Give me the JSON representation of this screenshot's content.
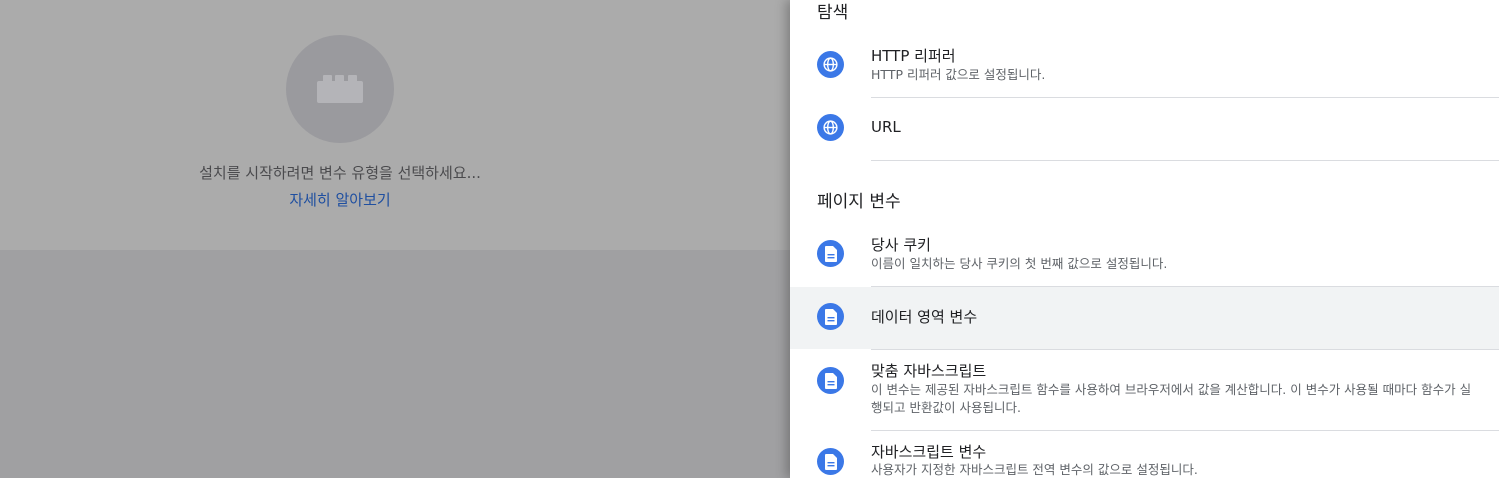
{
  "background": {
    "prompt": "설치를 시작하려면 변수 유형을 선택하세요...",
    "learn_more": "자세히 알아보기"
  },
  "panel": {
    "sections": [
      {
        "title": "탐색",
        "items": [
          {
            "title": "HTTP 리퍼러",
            "description": "HTTP 리퍼러 값으로 설정됩니다.",
            "icon": "globe-icon"
          },
          {
            "title": "URL",
            "description": "",
            "icon": "globe-icon"
          }
        ]
      },
      {
        "title": "페이지 변수",
        "items": [
          {
            "title": "당사 쿠키",
            "description": "이름이 일치하는 당사 쿠키의 첫 번째 값으로 설정됩니다.",
            "icon": "document-icon"
          },
          {
            "title": "데이터 영역 변수",
            "description": "",
            "icon": "document-icon",
            "selected": true
          },
          {
            "title": "맞춤 자바스크립트",
            "description": "이 변수는 제공된 자바스크립트 함수를 사용하여 브라우저에서 값을 계산합니다. 이 변수가 사용될 때마다 함수가 실행되고 반환값이 사용됩니다.",
            "icon": "document-icon"
          },
          {
            "title": "자바스크립트 변수",
            "description": "사용자가 지정한 자바스크립트 전역 변수의 값으로 설정됩니다.",
            "icon": "document-icon"
          }
        ]
      }
    ]
  },
  "colors": {
    "icon_bg": "#3b78e7",
    "selected_row": "#f1f3f4",
    "link": "#1f4fa0"
  }
}
